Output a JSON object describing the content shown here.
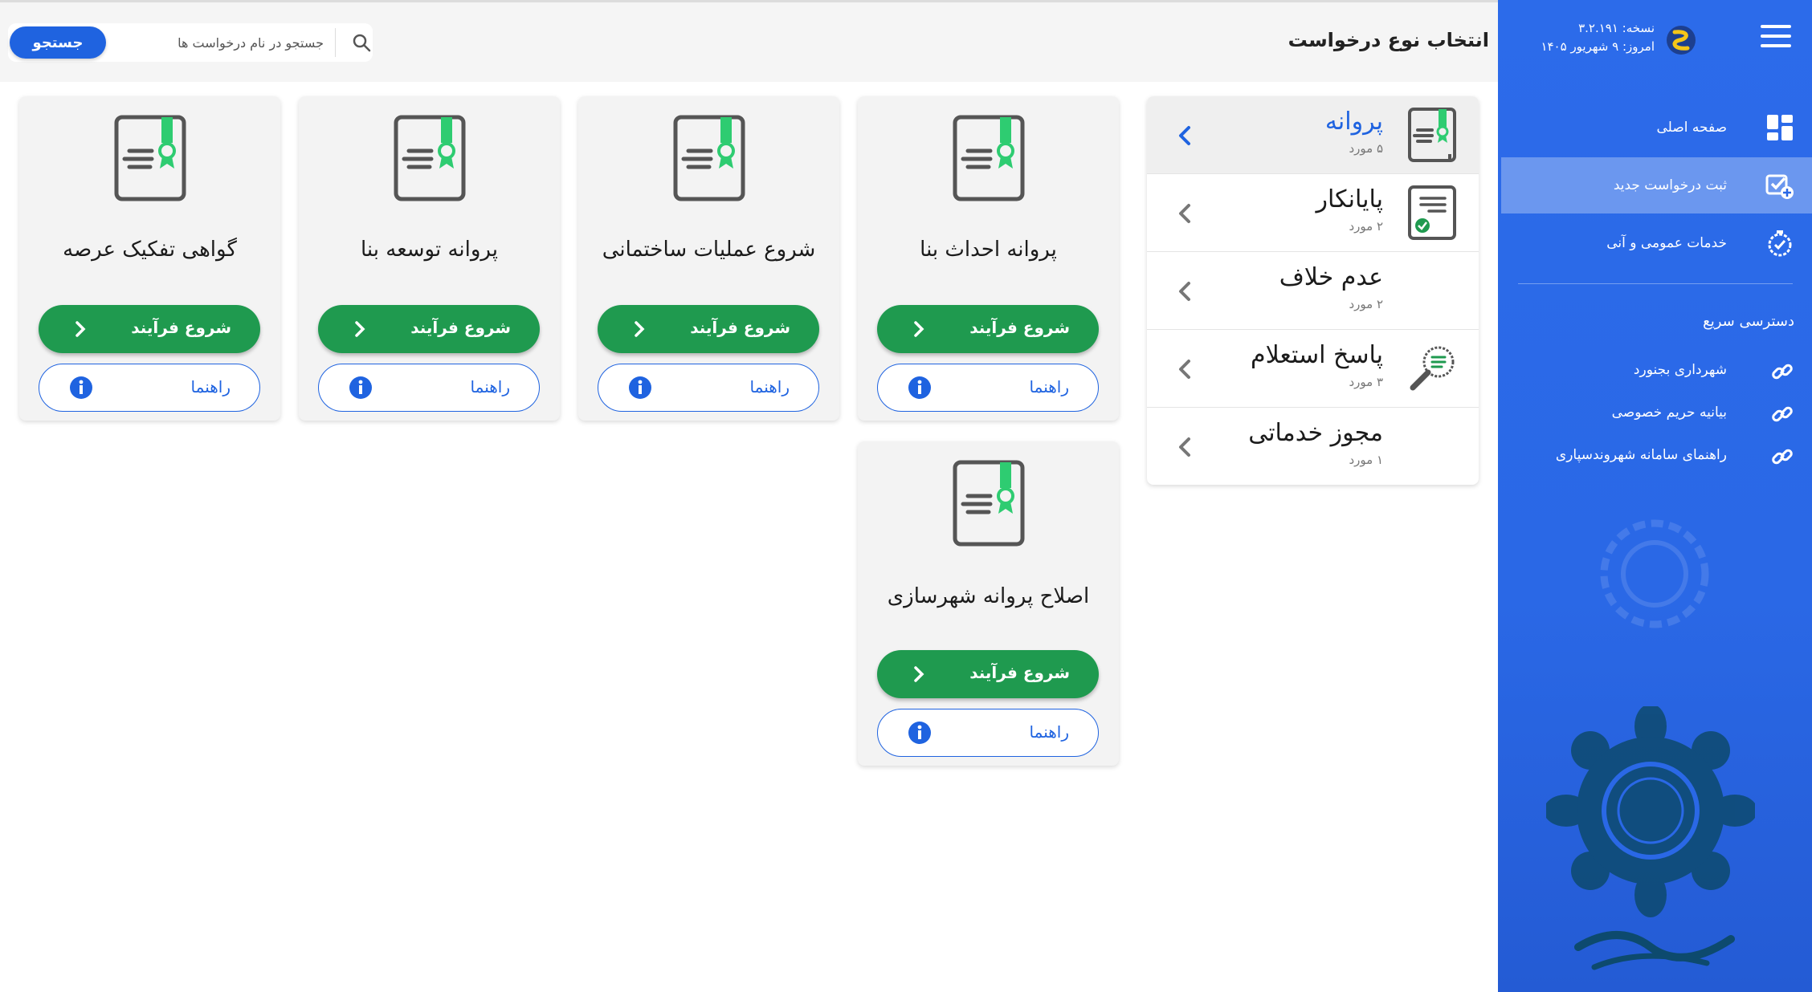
{
  "header": {
    "title": "انتخاب نوع درخواست",
    "search_placeholder": "جستجو در نام درخواست ها",
    "search_button": "جستجو"
  },
  "sidebar": {
    "version_line": "نسخه: ۳.۲.۱۹۱",
    "today_line": "امروز: ۹ شهریور ۱۴۰۵",
    "nav": [
      {
        "label": "صفحه اصلی",
        "icon": "dashboard-icon"
      },
      {
        "label": "ثبت درخواست جدید",
        "icon": "add-request-icon",
        "active": true
      },
      {
        "label": "خدمات عمومی و آنی",
        "icon": "timer-icon"
      }
    ],
    "quick_title": "دسترسی سریع",
    "quick_links": [
      {
        "label": "شهرداری بجنورد",
        "icon": "link-icon"
      },
      {
        "label": "بیانیه حریم خصوصی",
        "icon": "link-icon"
      },
      {
        "label": "راهنمای سامانه شهروندسپاری",
        "icon": "link-icon"
      }
    ],
    "emblem_label": "شهرداری بجنورد"
  },
  "categories": [
    {
      "name": "پروانه",
      "count": "۵ مورد",
      "icon": "license-book-icon",
      "active": true
    },
    {
      "name": "پایانکار",
      "count": "۲ مورد",
      "icon": "certificate-check-icon"
    },
    {
      "name": "عدم خلاف",
      "count": "۲ مورد",
      "icon": ""
    },
    {
      "name": "پاسخ استعلام",
      "count": "۳ مورد",
      "icon": "inquiry-magnifier-icon"
    },
    {
      "name": "مجوز خدماتی",
      "count": "۱ مورد",
      "icon": ""
    }
  ],
  "cards": [
    {
      "title": "پروانه احداث بنا",
      "start": "شروع فرآیند",
      "guide": "راهنما"
    },
    {
      "title": "شروع عملیات ساختمانی",
      "start": "شروع فرآیند",
      "guide": "راهنما"
    },
    {
      "title": "پروانه توسعه بنا",
      "start": "شروع فرآیند",
      "guide": "راهنما"
    },
    {
      "title": "گواهی تفکیک عرصه",
      "start": "شروع فرآیند",
      "guide": "راهنما"
    },
    {
      "title": "اصلاح پروانه شهرسازی",
      "start": "شروع فرآیند",
      "guide": "راهنما"
    }
  ],
  "colors": {
    "sidebar": "#2a68e6",
    "primary": "#1f63e0",
    "success": "#1f9a4f",
    "ribbon": "#2ecc71"
  }
}
